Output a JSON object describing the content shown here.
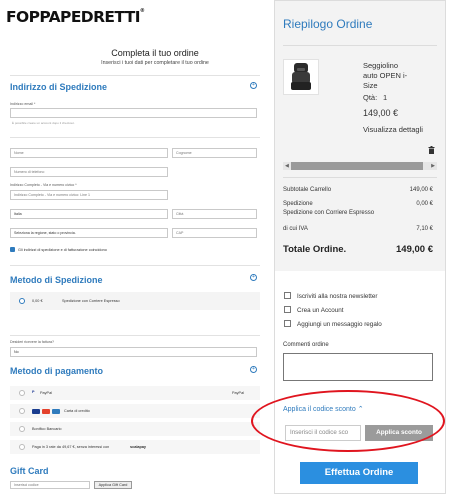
{
  "brand": {
    "name": "FOPPAPEDRETTI",
    "mark": "®"
  },
  "header": {
    "title": "Completa il tuo ordine",
    "subtitle": "Inserisci i tuoi dati per completare il tuo ordine"
  },
  "shipping_address": {
    "title": "Indirizzo di Spedizione",
    "email_label": "Indirizzo email *",
    "email_hint": "È possibile creare un account dopo il checkout.",
    "first_name_placeholder": "Nome",
    "last_name_placeholder": "Cognome",
    "phone_placeholder": "Numero di telefono",
    "street_label": "Indirizzo Completo - Via e numero civico *",
    "street_placeholder": "Indirizzo Completo - Via e numero civico: Line 1",
    "country_value": "Italia",
    "city_placeholder": "Città",
    "region_value": "Seleziona la regione, stato o provincia.",
    "zip_placeholder": "CAP",
    "same_address_label": "Gli indirizzi di spedizione e di fatturazione coincidono"
  },
  "shipping_method": {
    "title": "Metodo di Spedizione",
    "price": "0,00 €",
    "carrier": "Spedizione con Corriere Espresso"
  },
  "invoice": {
    "label": "Desideri ricevere la fattura?",
    "value": "No"
  },
  "payment": {
    "title": "Metodo di pagamento",
    "options": [
      {
        "label": "PayPal",
        "right_label": "PayPal"
      },
      {
        "label": "Carta di credito",
        "right_label": ""
      },
      {
        "label": "Bonifico Bancario",
        "right_label": ""
      },
      {
        "label": "Paga in 3 rate da 49,67 €, senza interessi con",
        "right_label": "",
        "brand": "scalapay"
      }
    ]
  },
  "gift_card": {
    "title": "Gift Card",
    "select_placeholder": "Inserisci codice",
    "button": "Applica Gift Card"
  },
  "summary": {
    "title": "Riepilogo Ordine",
    "product": {
      "name_lines": [
        "Seggiolino",
        "auto OPEN i-",
        "Size"
      ],
      "qty_label": "Qtà:",
      "qty": "1",
      "price": "149,00 €",
      "details_link": "Visualizza dettagli"
    },
    "subtotal_label": "Subtotale Carrello",
    "subtotal_value": "149,00 €",
    "shipping_label": "Spedizione",
    "shipping_sub": "Spedizione con Corriere Espresso",
    "shipping_value": "0,00 €",
    "vat_label": "di cui IVA",
    "vat_value": "7,10 €",
    "total_label": "Totale Ordine.",
    "total_value": "149,00 €"
  },
  "options": {
    "newsletter": "Iscriviti alla nostra newsletter",
    "account": "Crea un Account",
    "gift_message": "Aggiungi un messaggio regalo"
  },
  "comments": {
    "label": "Commenti ordine"
  },
  "coupon": {
    "toggle": "Applica il codice sconto",
    "placeholder": "Inserisci il codice sco",
    "button": "Applica sconto"
  },
  "place_order": {
    "label": "Effettua Ordine"
  },
  "colors": {
    "accent": "#2f7bbd",
    "order_button": "#2b8fe0",
    "highlight": "#e0151f"
  }
}
